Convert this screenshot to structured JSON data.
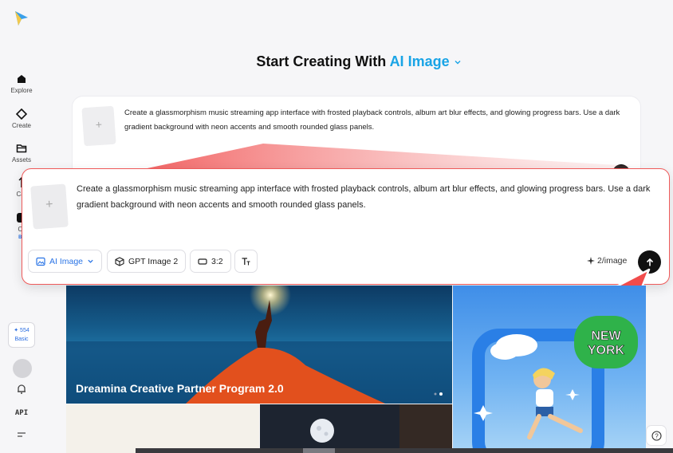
{
  "sidebar": {
    "logo": "dreamina-logo",
    "items": [
      {
        "label": "Explore",
        "icon": "home-icon"
      },
      {
        "label": "Create",
        "icon": "diamond-icon"
      },
      {
        "label": "Assets",
        "icon": "folder-icon"
      },
      {
        "label": "Car",
        "icon": "canvas-icon"
      },
      {
        "label": "Or",
        "icon": "omni-icon",
        "badge": "Be"
      }
    ],
    "credits": {
      "value": "✦ 554",
      "plan": "Basic"
    },
    "api_label": "API"
  },
  "header": {
    "prefix": "Start Creating With ",
    "mode": "AI Image"
  },
  "prompt": {
    "text": "Create a glassmorphism music streaming app interface with frosted playback controls, album art blur effects, and glowing progress bars. Use a dark gradient background with neon accents and smooth rounded glass panels.",
    "thumb_placeholder": "+"
  },
  "toolbar": {
    "mode_label": "AI Image",
    "model_label": "GPT Image 2",
    "ratio_label": "3:2",
    "cost_label": "2/image"
  },
  "gallery": {
    "banner_title": "Dreamina Creative Partner Program 2.0",
    "promo_text": "NEW YORK"
  },
  "help_label": "?",
  "colors": {
    "accent": "#19a4e6",
    "highlight": "#ef5a5a",
    "link": "#2a74e6"
  }
}
